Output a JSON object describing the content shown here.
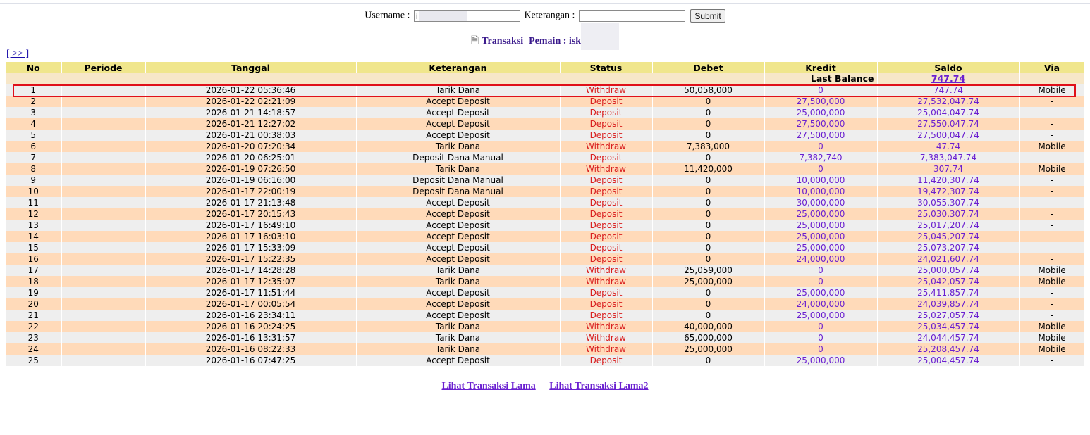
{
  "form": {
    "username_label": "Username :",
    "username_value": "i",
    "keterangan_label": "Keterangan :",
    "keterangan_value": "",
    "submit_label": "Submit"
  },
  "heading": {
    "icon": "document-icon",
    "title": "Transaksi",
    "player_label": "Pemain : isk"
  },
  "nav": {
    "next_link": "[ >> ]"
  },
  "table": {
    "headers": [
      "No",
      "Periode",
      "Tanggal",
      "Keterangan",
      "Status",
      "Debet",
      "Kredit",
      "Saldo",
      "Via"
    ],
    "last_balance_label": "Last Balance",
    "last_balance_value": "747.74",
    "rows": [
      {
        "no": "1",
        "periode": "",
        "tanggal": "2026-01-22 05:36:46",
        "keterangan": "Tarik Dana",
        "status": "Withdraw",
        "debet": "50,058,000",
        "kredit": "0",
        "saldo": "747.74",
        "via": "Mobile"
      },
      {
        "no": "2",
        "periode": "",
        "tanggal": "2026-01-22 02:21:09",
        "keterangan": "Accept Deposit",
        "status": "Deposit",
        "debet": "0",
        "kredit": "27,500,000",
        "saldo": "27,532,047.74",
        "via": "-"
      },
      {
        "no": "3",
        "periode": "",
        "tanggal": "2026-01-21 14:18:57",
        "keterangan": "Accept Deposit",
        "status": "Deposit",
        "debet": "0",
        "kredit": "25,000,000",
        "saldo": "25,004,047.74",
        "via": "-"
      },
      {
        "no": "4",
        "periode": "",
        "tanggal": "2026-01-21 12:27:02",
        "keterangan": "Accept Deposit",
        "status": "Deposit",
        "debet": "0",
        "kredit": "27,500,000",
        "saldo": "27,550,047.74",
        "via": "-"
      },
      {
        "no": "5",
        "periode": "",
        "tanggal": "2026-01-21 00:38:03",
        "keterangan": "Accept Deposit",
        "status": "Deposit",
        "debet": "0",
        "kredit": "27,500,000",
        "saldo": "27,500,047.74",
        "via": "-"
      },
      {
        "no": "6",
        "periode": "",
        "tanggal": "2026-01-20 07:20:34",
        "keterangan": "Tarik Dana",
        "status": "Withdraw",
        "debet": "7,383,000",
        "kredit": "0",
        "saldo": "47.74",
        "via": "Mobile"
      },
      {
        "no": "7",
        "periode": "",
        "tanggal": "2026-01-20 06:25:01",
        "keterangan": "Deposit Dana Manual",
        "status": "Deposit",
        "debet": "0",
        "kredit": "7,382,740",
        "saldo": "7,383,047.74",
        "via": "-"
      },
      {
        "no": "8",
        "periode": "",
        "tanggal": "2026-01-19 07:26:50",
        "keterangan": "Tarik Dana",
        "status": "Withdraw",
        "debet": "11,420,000",
        "kredit": "0",
        "saldo": "307.74",
        "via": "Mobile"
      },
      {
        "no": "9",
        "periode": "",
        "tanggal": "2026-01-19 06:16:00",
        "keterangan": "Deposit Dana Manual",
        "status": "Deposit",
        "debet": "0",
        "kredit": "10,000,000",
        "saldo": "11,420,307.74",
        "via": "-"
      },
      {
        "no": "10",
        "periode": "",
        "tanggal": "2026-01-17 22:00:19",
        "keterangan": "Deposit Dana Manual",
        "status": "Deposit",
        "debet": "0",
        "kredit": "10,000,000",
        "saldo": "19,472,307.74",
        "via": "-"
      },
      {
        "no": "11",
        "periode": "",
        "tanggal": "2026-01-17 21:13:48",
        "keterangan": "Accept Deposit",
        "status": "Deposit",
        "debet": "0",
        "kredit": "30,000,000",
        "saldo": "30,055,307.74",
        "via": "-"
      },
      {
        "no": "12",
        "periode": "",
        "tanggal": "2026-01-17 20:15:43",
        "keterangan": "Accept Deposit",
        "status": "Deposit",
        "debet": "0",
        "kredit": "25,000,000",
        "saldo": "25,030,307.74",
        "via": "-"
      },
      {
        "no": "13",
        "periode": "",
        "tanggal": "2026-01-17 16:49:10",
        "keterangan": "Accept Deposit",
        "status": "Deposit",
        "debet": "0",
        "kredit": "25,000,000",
        "saldo": "25,017,207.74",
        "via": "-"
      },
      {
        "no": "14",
        "periode": "",
        "tanggal": "2026-01-17 16:03:10",
        "keterangan": "Accept Deposit",
        "status": "Deposit",
        "debet": "0",
        "kredit": "25,000,000",
        "saldo": "25,045,207.74",
        "via": "-"
      },
      {
        "no": "15",
        "periode": "",
        "tanggal": "2026-01-17 15:33:09",
        "keterangan": "Accept Deposit",
        "status": "Deposit",
        "debet": "0",
        "kredit": "25,000,000",
        "saldo": "25,073,207.74",
        "via": "-"
      },
      {
        "no": "16",
        "periode": "",
        "tanggal": "2026-01-17 15:22:35",
        "keterangan": "Accept Deposit",
        "status": "Deposit",
        "debet": "0",
        "kredit": "24,000,000",
        "saldo": "24,021,607.74",
        "via": "-"
      },
      {
        "no": "17",
        "periode": "",
        "tanggal": "2026-01-17 14:28:28",
        "keterangan": "Tarik Dana",
        "status": "Withdraw",
        "debet": "25,059,000",
        "kredit": "0",
        "saldo": "25,000,057.74",
        "via": "Mobile"
      },
      {
        "no": "18",
        "periode": "",
        "tanggal": "2026-01-17 12:35:07",
        "keterangan": "Tarik Dana",
        "status": "Withdraw",
        "debet": "25,000,000",
        "kredit": "0",
        "saldo": "25,042,057.74",
        "via": "Mobile"
      },
      {
        "no": "19",
        "periode": "",
        "tanggal": "2026-01-17 11:51:44",
        "keterangan": "Accept Deposit",
        "status": "Deposit",
        "debet": "0",
        "kredit": "25,000,000",
        "saldo": "25,411,857.74",
        "via": "-"
      },
      {
        "no": "20",
        "periode": "",
        "tanggal": "2026-01-17 00:05:54",
        "keterangan": "Accept Deposit",
        "status": "Deposit",
        "debet": "0",
        "kredit": "24,000,000",
        "saldo": "24,039,857.74",
        "via": "-"
      },
      {
        "no": "21",
        "periode": "",
        "tanggal": "2026-01-16 23:34:11",
        "keterangan": "Accept Deposit",
        "status": "Deposit",
        "debet": "0",
        "kredit": "25,000,000",
        "saldo": "25,027,057.74",
        "via": "-"
      },
      {
        "no": "22",
        "periode": "",
        "tanggal": "2026-01-16 20:24:25",
        "keterangan": "Tarik Dana",
        "status": "Withdraw",
        "debet": "40,000,000",
        "kredit": "0",
        "saldo": "25,034,457.74",
        "via": "Mobile"
      },
      {
        "no": "23",
        "periode": "",
        "tanggal": "2026-01-16 13:31:57",
        "keterangan": "Tarik Dana",
        "status": "Withdraw",
        "debet": "65,000,000",
        "kredit": "0",
        "saldo": "24,044,457.74",
        "via": "Mobile"
      },
      {
        "no": "24",
        "periode": "",
        "tanggal": "2026-01-16 08:22:33",
        "keterangan": "Tarik Dana",
        "status": "Withdraw",
        "debet": "25,000,000",
        "kredit": "0",
        "saldo": "25,208,457.74",
        "via": "Mobile"
      },
      {
        "no": "25",
        "periode": "",
        "tanggal": "2026-01-16 07:47:25",
        "keterangan": "Accept Deposit",
        "status": "Deposit",
        "debet": "0",
        "kredit": "25,000,000",
        "saldo": "25,004,457.74",
        "via": "-"
      }
    ]
  },
  "footer": {
    "old_transactions_link": "Lihat Transaksi Lama",
    "old_transactions2_link": "Lihat Transaksi Lama2"
  },
  "colors": {
    "header_bg": "#f0e68c",
    "row_odd_bg": "#eeeeee",
    "row_even_bg": "#ffdab9",
    "status_red": "#d91f1f",
    "link_purple": "#6a1fd0",
    "highlight_red": "#e0101a"
  }
}
